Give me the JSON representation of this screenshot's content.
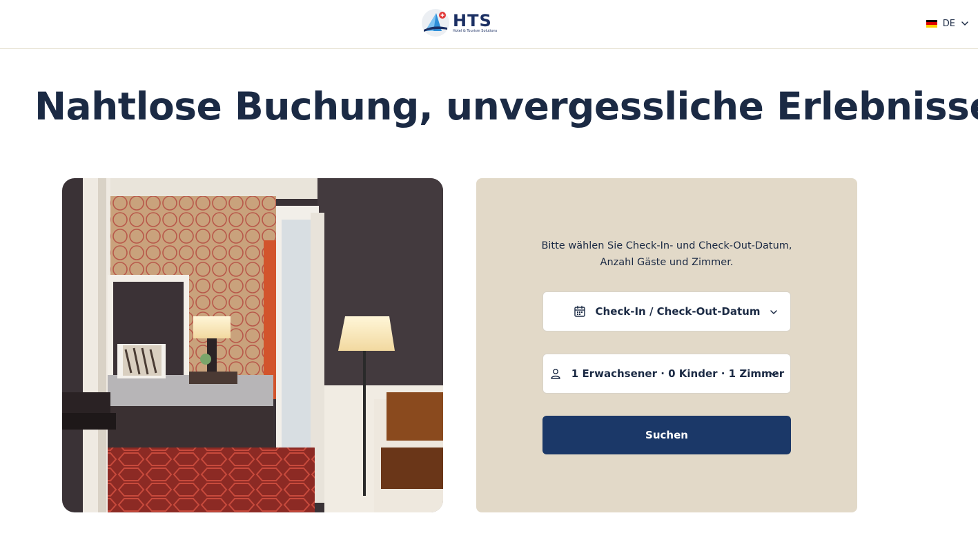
{
  "header": {
    "logo_text": "HTS",
    "logo_tagline": "Hotel & Tourism Solutions",
    "language": {
      "code": "DE",
      "flag_colors": [
        "#000000",
        "#dd0000",
        "#ffce00"
      ]
    }
  },
  "hero": {
    "headline": "Nahtlose Buchung, unvergessliche Erlebnisse."
  },
  "booking": {
    "intro_line1": "Bitte wählen Sie Check-In- und Check-Out-Datum,",
    "intro_line2": "Anzahl Gäste und Zimmer.",
    "dates_label": "Check-In / Check-Out-Datum",
    "guests_label": "1 Erwachsener · 0 Kinder · 1 Zimmer",
    "search_label": "Suchen"
  },
  "colors": {
    "primary": "#1b3868",
    "panel_background": "#e2d9c8",
    "text": "#1b2a44"
  },
  "icons": [
    "calendar-icon",
    "person-icon",
    "chevron-down-icon",
    "hts-logo"
  ]
}
